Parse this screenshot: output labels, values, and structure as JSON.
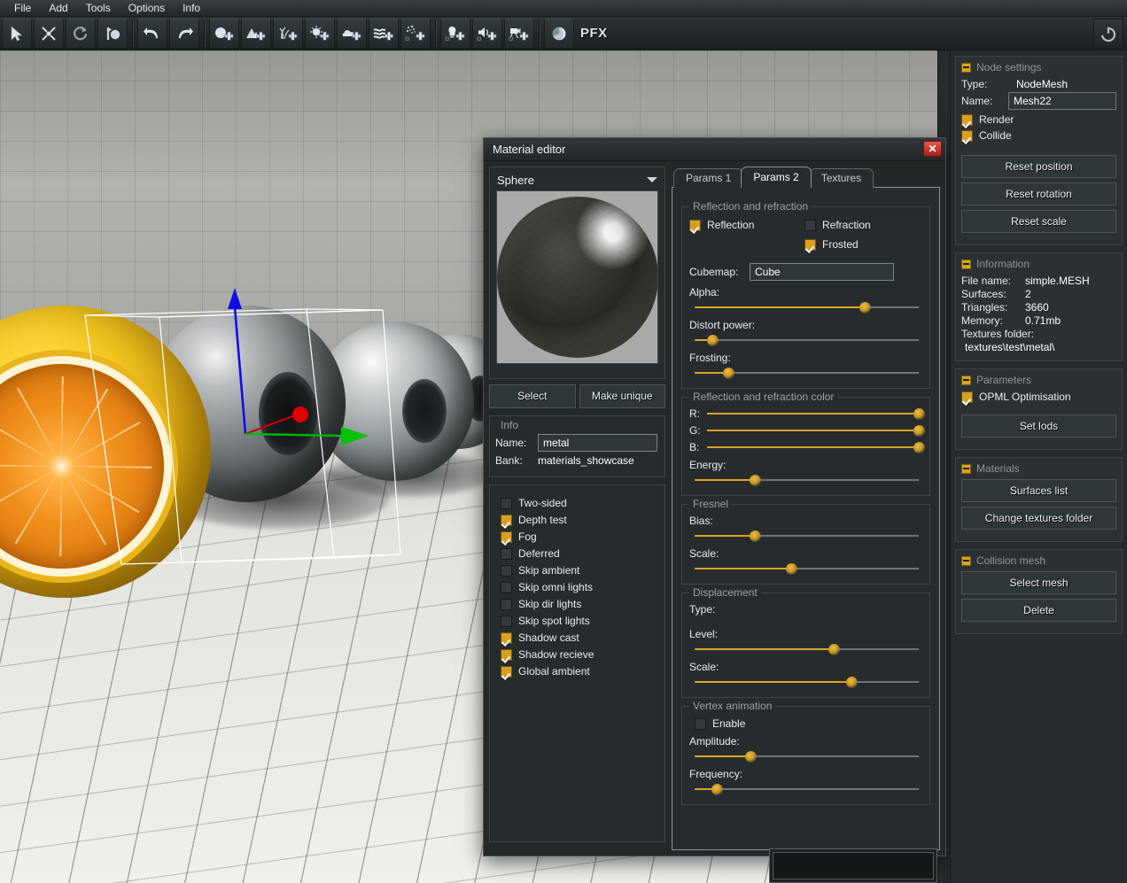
{
  "menubar": {
    "items": [
      {
        "label": "File",
        "name": "menu-file"
      },
      {
        "label": "Add",
        "name": "menu-add"
      },
      {
        "label": "Tools",
        "name": "menu-tools"
      },
      {
        "label": "Options",
        "name": "menu-options"
      },
      {
        "label": "Info",
        "name": "menu-info"
      }
    ]
  },
  "toolbar": {
    "pfx_label": "PFX",
    "icons": [
      "select-arrow-icon",
      "move-icon",
      "rotate-icon",
      "scale-icon",
      "undo-icon",
      "redo-icon",
      "add-mesh-icon",
      "add-terrain-icon",
      "add-grass-icon",
      "add-particle-icon",
      "add-cloud-icon",
      "add-water-icon",
      "add-dust-icon",
      "add-light-icon",
      "add-sound-icon",
      "add-camera-icon",
      "material-sphere-icon"
    ],
    "power_icon": "power-icon"
  },
  "material_editor": {
    "title": "Material editor",
    "close_label": "✕",
    "preview": {
      "shape_label": "Sphere",
      "dropdown_icon": "chevron-down-icon",
      "select_label": "Select",
      "make_unique_label": "Make unique"
    },
    "info": {
      "legend": "Info",
      "name_label": "Name:",
      "name_value": "metal",
      "bank_label": "Bank:",
      "bank_value": "materials_showcase"
    },
    "flags": [
      {
        "label": "Two-sided",
        "checked": false
      },
      {
        "label": "Depth test",
        "checked": true
      },
      {
        "label": "Fog",
        "checked": true
      },
      {
        "label": "Deferred",
        "checked": false
      },
      {
        "label": "Skip ambient",
        "checked": false
      },
      {
        "label": "Skip omni lights",
        "checked": false
      },
      {
        "label": "Skip dir lights",
        "checked": false
      },
      {
        "label": "Skip spot lights",
        "checked": false
      },
      {
        "label": "Shadow cast",
        "checked": true
      },
      {
        "label": "Shadow recieve",
        "checked": true
      },
      {
        "label": "Global ambient",
        "checked": true
      }
    ],
    "tabs": [
      {
        "label": "Params 1",
        "active": false
      },
      {
        "label": "Params 2",
        "active": true
      },
      {
        "label": "Textures",
        "active": false
      }
    ],
    "sections": {
      "reflection_refraction": {
        "legend": "Reflection and refraction",
        "reflection": {
          "label": "Reflection",
          "checked": true
        },
        "refraction": {
          "label": "Refraction",
          "checked": false
        },
        "frosted": {
          "label": "Frosted",
          "checked": true
        },
        "cubemap_label": "Cubemap:",
        "cubemap_value": "Cube",
        "sliders": [
          {
            "label": "Alpha:",
            "value": 76
          },
          {
            "label": "Distort power:",
            "value": 8
          },
          {
            "label": "Frosting:",
            "value": 15
          }
        ]
      },
      "reflection_color": {
        "legend": "Reflection and refraction color",
        "sliders": [
          {
            "label": "R:",
            "value": 100
          },
          {
            "label": "G:",
            "value": 100
          },
          {
            "label": "B:",
            "value": 100
          },
          {
            "label": "Energy:",
            "value": 27
          }
        ]
      },
      "fresnel": {
        "legend": "Fresnel",
        "sliders": [
          {
            "label": "Bias:",
            "value": 27
          },
          {
            "label": "Scale:",
            "value": 43
          }
        ]
      },
      "displacement": {
        "legend": "Displacement",
        "type_label": "Type:",
        "sliders": [
          {
            "label": "Level:",
            "value": 62
          },
          {
            "label": "Scale:",
            "value": 70
          }
        ]
      },
      "vertex_animation": {
        "legend": "Vertex animation",
        "enable": {
          "label": "Enable",
          "checked": false
        },
        "sliders": [
          {
            "label": "Amplitude:",
            "value": 25
          },
          {
            "label": "Frequency:",
            "value": 10
          }
        ]
      }
    }
  },
  "sidebar": {
    "node_settings": {
      "title": "Node settings",
      "collapse_icon": "minus-icon",
      "type_label": "Type:",
      "type_value": "NodeMesh",
      "name_label": "Name:",
      "name_value": "Mesh22",
      "render": {
        "label": "Render",
        "checked": true
      },
      "collide": {
        "label": "Collide",
        "checked": true
      },
      "buttons": [
        "Reset position",
        "Reset rotation",
        "Reset scale"
      ]
    },
    "information": {
      "title": "Information",
      "collapse_icon": "minus-icon",
      "rows": [
        {
          "label": "File name:",
          "value": "simple.MESH"
        },
        {
          "label": "Surfaces:",
          "value": "2"
        },
        {
          "label": "Triangles:",
          "value": "3660"
        },
        {
          "label": "Memory:",
          "value": "0.71mb"
        }
      ],
      "textures_folder_label": "Textures folder:",
      "textures_folder_value": "textures\\test\\metal\\"
    },
    "parameters": {
      "title": "Parameters",
      "collapse_icon": "minus-icon",
      "opml": {
        "label": "OPML Optimisation",
        "checked": true
      },
      "set_lods_label": "Set lods"
    },
    "materials": {
      "title": "Materials",
      "collapse_icon": "minus-icon",
      "buttons": [
        "Surfaces list",
        "Change textures folder"
      ]
    },
    "collision_mesh": {
      "title": "Collision mesh",
      "collapse_icon": "minus-icon",
      "buttons": [
        "Select mesh",
        "Delete"
      ]
    }
  },
  "viewport": {
    "name": "3d-viewport",
    "gizmo": {
      "x_axis_color": "#d40000",
      "y_axis_color": "#0000ee",
      "z_axis_color": "#00c000"
    },
    "selection_box_color": "#ffffff"
  },
  "colors": {
    "accent": "#d8a422",
    "panel_bg": "#262c2e",
    "window_bg": "#232829",
    "close_red": "#c13128"
  }
}
